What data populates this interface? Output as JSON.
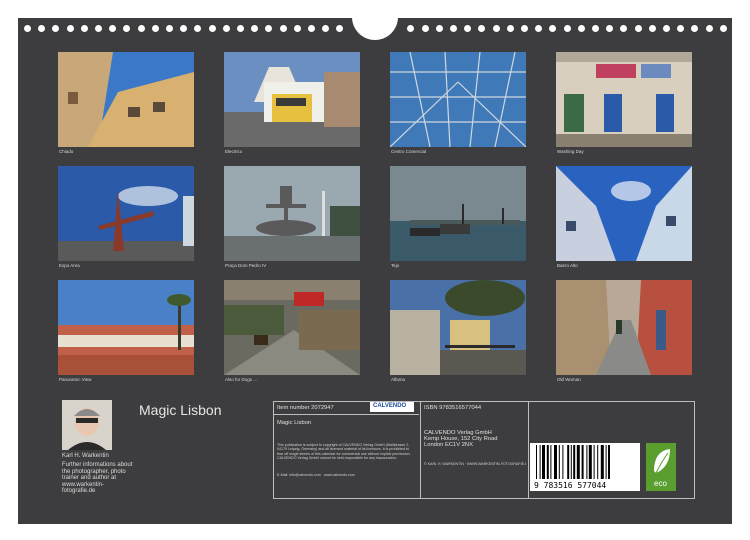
{
  "calendar": {
    "title": "Magic Lisbon",
    "photos": [
      {
        "caption": "Chiado"
      },
      {
        "caption": "Electrico"
      },
      {
        "caption": "Centro Comercial"
      },
      {
        "caption": "Washing Day"
      },
      {
        "caption": "Expo Area"
      },
      {
        "caption": "Praça Dom Pedro IV"
      },
      {
        "caption": "Tejo"
      },
      {
        "caption": "Bairro Alto"
      },
      {
        "caption": "Panoramic View"
      },
      {
        "caption": "Also for Dogs ..."
      },
      {
        "caption": "Alfama"
      },
      {
        "caption": "Old Woman"
      }
    ]
  },
  "author": {
    "name": "Karl H. Warkentin",
    "info": "Further informations about the photographer, photo trainer and author at www.warkentin-fotografie.de"
  },
  "info": {
    "item_number": "Item number 2072947",
    "calvendo_logo": "CALVENDO",
    "book_title": "Magic Lisbon",
    "legal": "This publication is subject to copyright of CALVENDO Verlag GmbH (Wallstrasse 2, 04179 Leipzig, Germany) and all licensed material of its licensors. It is prohibited to tear off single sheets of this calendar for commercial use without explicit permission. CALVENDO Verlag GmbH cannot be held responsible for any inaccuracies.",
    "contact": "E-Mail: info@calvendo.com · www.calvendo.com",
    "isbn": "ISBN 9783516577044",
    "publisher": "CALVENDO Verlag GmbH",
    "address1": "Kemp House, 152 City Road",
    "address2": "London EC1V 2NX",
    "copyright": "© KARL H. WARKENTIN · WWW.WARKENTIN-FOTOGRAFIE.DE",
    "barcode_number": "9 783516 577044",
    "eco_label": "eco"
  }
}
